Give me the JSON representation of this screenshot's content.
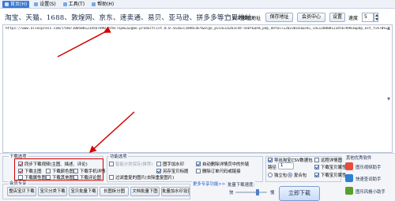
{
  "menubar": {
    "items": [
      {
        "label": "首页(H)",
        "icon": "home-icon"
      },
      {
        "label": "设置(S)",
        "icon": "settings-icon"
      },
      {
        "label": "工具(T)",
        "icon": "tools-icon"
      },
      {
        "label": "帮助(H)",
        "icon": "help-icon"
      }
    ]
  },
  "address": {
    "label": "淘宝、天猫、1688、敦煌网、京东、速卖通、易贝、亚马逊、拼多多等宝贝地址:",
    "auto_open_label": "自动触刷地址",
    "save_button": "保存地址",
    "member_button": "会员中心",
    "settings_button": "设置",
    "speed_label": "速度",
    "speed_value": "5"
  },
  "url_text": "https://www.aliexpress.com/item/1005001234567890.html?spm=a2g0o.productlist.0.0.5a1b2c3dAbCdEf&algo_pvid=1a2b3c4d-5e6f&aem_p4p_detail=20230101&sku_id=12000012345678901&pdp_ext_f=%7B%22sku_id%22%3A%2212000012345678901%22%7D&pdp_npi=2%40dis%21USD%2112.34%2110.99",
  "download_options": {
    "title": "下载选项",
    "options": [
      {
        "label": "同步下载视频(主图、描述、评论)",
        "checked": true
      },
      {
        "label": "下载主图",
        "checked": true
      },
      {
        "label": "下载颜色图",
        "checked": false
      },
      {
        "label": "下载手机详情",
        "checked": false
      },
      {
        "label": "下载属性图",
        "checked": false
      },
      {
        "label": "下载其他图",
        "checked": false
      },
      {
        "label": "下载评论图",
        "checked": false
      }
    ]
  },
  "function_options": {
    "title": "功能选项",
    "options": [
      {
        "label": "智能分类保存(推荐)",
        "checked": false,
        "disabled": true
      },
      {
        "label": "图字加水印",
        "checked": false
      },
      {
        "label": "另存宝贝标题",
        "checked": true
      },
      {
        "label": "过滤重复的图片(去除重复图片)",
        "checked": false
      },
      {
        "label": "自动删除详情页中的外链",
        "checked": true
      },
      {
        "label": "删除订单尺码或链接",
        "checked": false
      }
    ]
  },
  "export_options": {
    "options": [
      {
        "label": "导出淘宝CSV数据包",
        "checked": true
      },
      {
        "label": "远程详情图",
        "checked": false
      },
      {
        "label": "下载宝贝属性",
        "checked": true
      },
      {
        "label": "下载宝贝属性",
        "checked": true
      }
    ],
    "dropdown_label": "路径",
    "dropdown_value": "1",
    "radio_a": "独立包",
    "radio_b": "复合包"
  },
  "member_tools": {
    "title": "会员专享",
    "buttons": [
      "整店宝贝下载",
      "宝贝分类下载",
      "宝贝批量下载",
      "长图拆分图",
      "文档批量下图",
      "批量加水印设置"
    ]
  },
  "more_tools": {
    "title": "更多专享功能>>"
  },
  "batch_download": {
    "title": "批量下载速度:",
    "slow_label": "快",
    "fast_label": "慢"
  },
  "download_button": "立即下载",
  "side_tools": {
    "title": "其他优秀软件",
    "items": [
      {
        "label": "图乐视频助手",
        "color": "#e94b3c"
      },
      {
        "label": "快速查词助手",
        "color": "#2f7fd6"
      },
      {
        "label": "图乐风格小助手",
        "color": "#5a9e2f"
      }
    ]
  },
  "colors": {
    "accent": "#3a78d6",
    "annotation": "#d40000"
  }
}
